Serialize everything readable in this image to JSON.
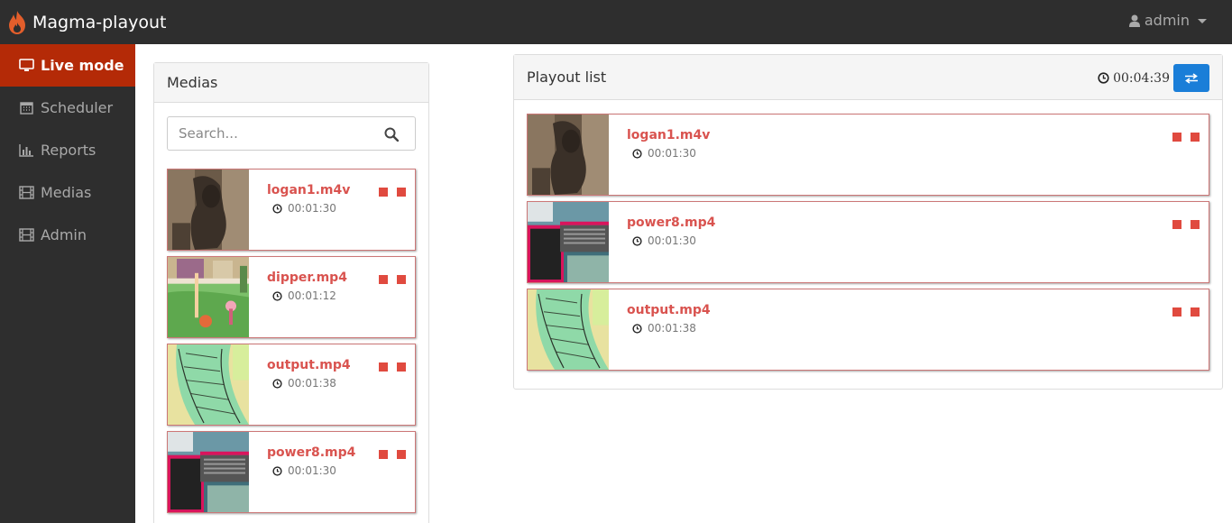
{
  "app": {
    "title": "Magma-playout",
    "brand_color": "#e35e2b"
  },
  "user": {
    "name": "admin"
  },
  "sidebar": {
    "items": [
      {
        "label": "Live mode",
        "icon": "monitor-icon",
        "active": true
      },
      {
        "label": "Scheduler",
        "icon": "calendar-icon",
        "active": false
      },
      {
        "label": "Reports",
        "icon": "bar-chart-icon",
        "active": false
      },
      {
        "label": "Medias",
        "icon": "film-icon",
        "active": false
      },
      {
        "label": "Admin",
        "icon": "film-icon",
        "active": false
      }
    ]
  },
  "medias": {
    "title": "Medias",
    "search_placeholder": "Search...",
    "items": [
      {
        "name": "logan1.m4v",
        "duration": "00:01:30",
        "thumb": "dark"
      },
      {
        "name": "dipper.mp4",
        "duration": "00:01:12",
        "thumb": "cartoon"
      },
      {
        "name": "output.mp4",
        "duration": "00:01:38",
        "thumb": "green"
      },
      {
        "name": "power8.mp4",
        "duration": "00:01:30",
        "thumb": "screen"
      }
    ]
  },
  "playout": {
    "title": "Playout list",
    "total_duration": "00:04:39",
    "swap_icon": "exchange-icon",
    "items": [
      {
        "name": "logan1.m4v",
        "duration": "00:01:30",
        "thumb": "dark"
      },
      {
        "name": "power8.mp4",
        "duration": "00:01:30",
        "thumb": "screen"
      },
      {
        "name": "output.mp4",
        "duration": "00:01:38",
        "thumb": "green"
      }
    ]
  },
  "colors": {
    "accent": "#d9534f",
    "active_nav": "#b42a07",
    "button": "#1a7ed8"
  }
}
